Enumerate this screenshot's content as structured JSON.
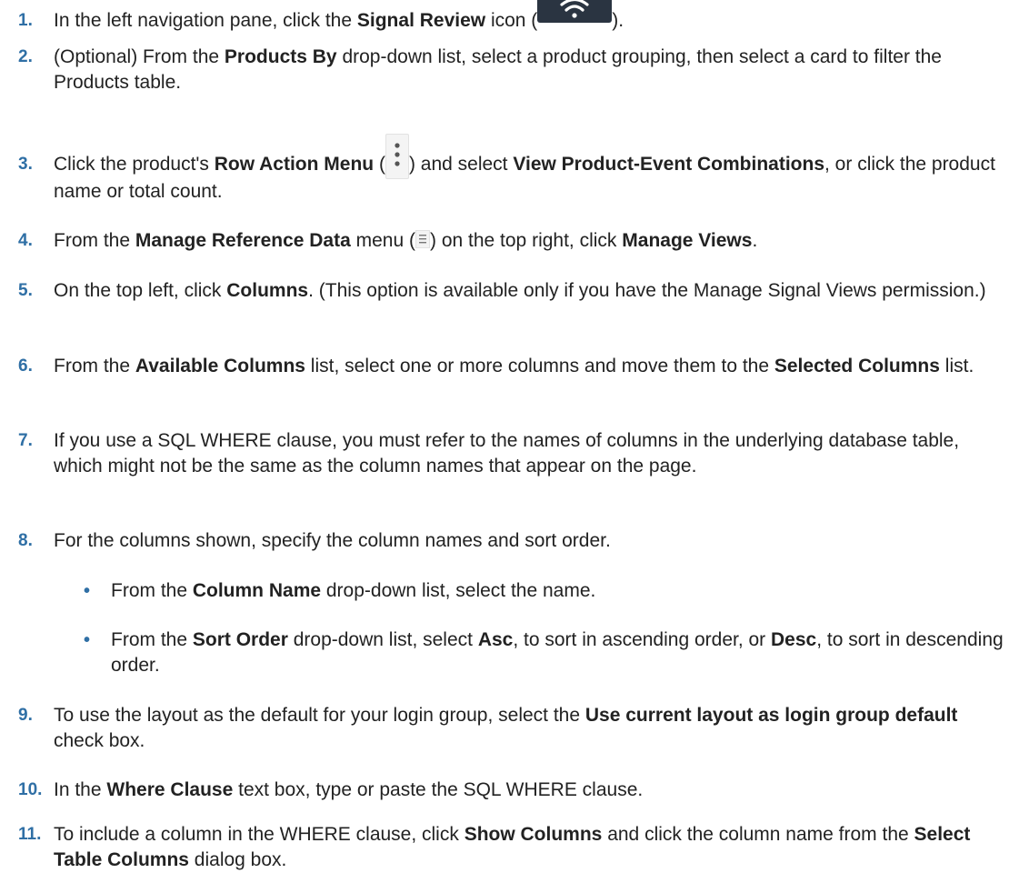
{
  "steps": [
    {
      "num": "1.",
      "t1": "In the left navigation pane, click the ",
      "b1": "Signal Review",
      "t2": " icon (",
      "icon": "wifi-icon",
      "t3": ")."
    },
    {
      "num": "2.",
      "t1": "(Optional) From the ",
      "b1": "Products By",
      "t2": " drop-down list, select a product grouping, then select a card to filter the Products table."
    },
    {
      "num": "3.",
      "t1": "Click the product's ",
      "b1": "Row Action Menu",
      "t2": " (",
      "icon": "kebab-menu-icon",
      "t3": ") and select ",
      "b2": "View Product-Event Combinations",
      "t4": ", or click the product name or total count."
    },
    {
      "num": "4.",
      "t1": "From the ",
      "b1": "Manage Reference Data",
      "t2": " menu (",
      "icon": "hamburger-menu-icon",
      "t3": ") on the top right, click ",
      "b2": "Manage Views",
      "t4": "."
    },
    {
      "num": "5.",
      "t1": "On the top left, click ",
      "b1": "Columns",
      "t2": ". (This option is available only if you have the Manage Signal Views permission.)"
    },
    {
      "num": "6.",
      "t1": "From the ",
      "b1": "Available Columns",
      "t2": " list, select one or more columns and move them to the ",
      "b2": "Selected Columns",
      "t3": " list."
    },
    {
      "num": "7.",
      "t1": "If you use a SQL WHERE clause, you must refer to the names of columns in the underlying database table, which might not be the same as the column names that appear on the page."
    },
    {
      "num": "8.",
      "t1": "For the columns shown, specify the column names and sort order.",
      "bullets": [
        {
          "t1": "From the ",
          "b1": "Column Name",
          "t2": " drop-down list, select the name."
        },
        {
          "t1": "From the ",
          "b1": "Sort Order",
          "t2": " drop-down list, select ",
          "b2": "Asc",
          "t3": ", to sort in ascending order, or ",
          "b3": "Desc",
          "t4": ", to sort in descending order."
        }
      ]
    },
    {
      "num": "9.",
      "t1": "To use the layout as the default for your login group, select the ",
      "b1": "Use current layout as login group default",
      "t2": " check box."
    },
    {
      "num": "10.",
      "t1": "In the ",
      "b1": "Where Clause",
      "t2": " text box, type or paste the SQL WHERE clause."
    },
    {
      "num": "11.",
      "t1": "To include a column in the WHERE clause, click ",
      "b1": "Show Columns",
      "t2": " and click the column name from the ",
      "b2": "Select Table Columns",
      "t3": " dialog box."
    }
  ],
  "bullet_char": "•",
  "colors": {
    "step_number": "#2f6fa5",
    "text": "#222222",
    "wifi_icon_bg": "#2a3441"
  }
}
